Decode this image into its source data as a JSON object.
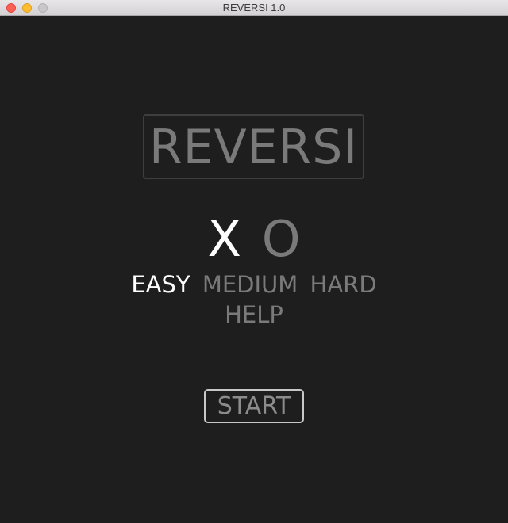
{
  "window": {
    "title": "REVERSI 1.0"
  },
  "logo": {
    "text": "REVERSI"
  },
  "pieces": {
    "x_label": "X",
    "o_label": "O",
    "selected": "X"
  },
  "difficulty": {
    "options": [
      "EASY",
      "MEDIUM",
      "HARD"
    ],
    "selected": "EASY"
  },
  "help": {
    "label": "HELP"
  },
  "start": {
    "label": "START"
  },
  "colors": {
    "background": "#1e1e1e",
    "selected_text": "#ffffff",
    "unselected_text": "#7a7a7a",
    "start_border": "#c8c8c8"
  }
}
